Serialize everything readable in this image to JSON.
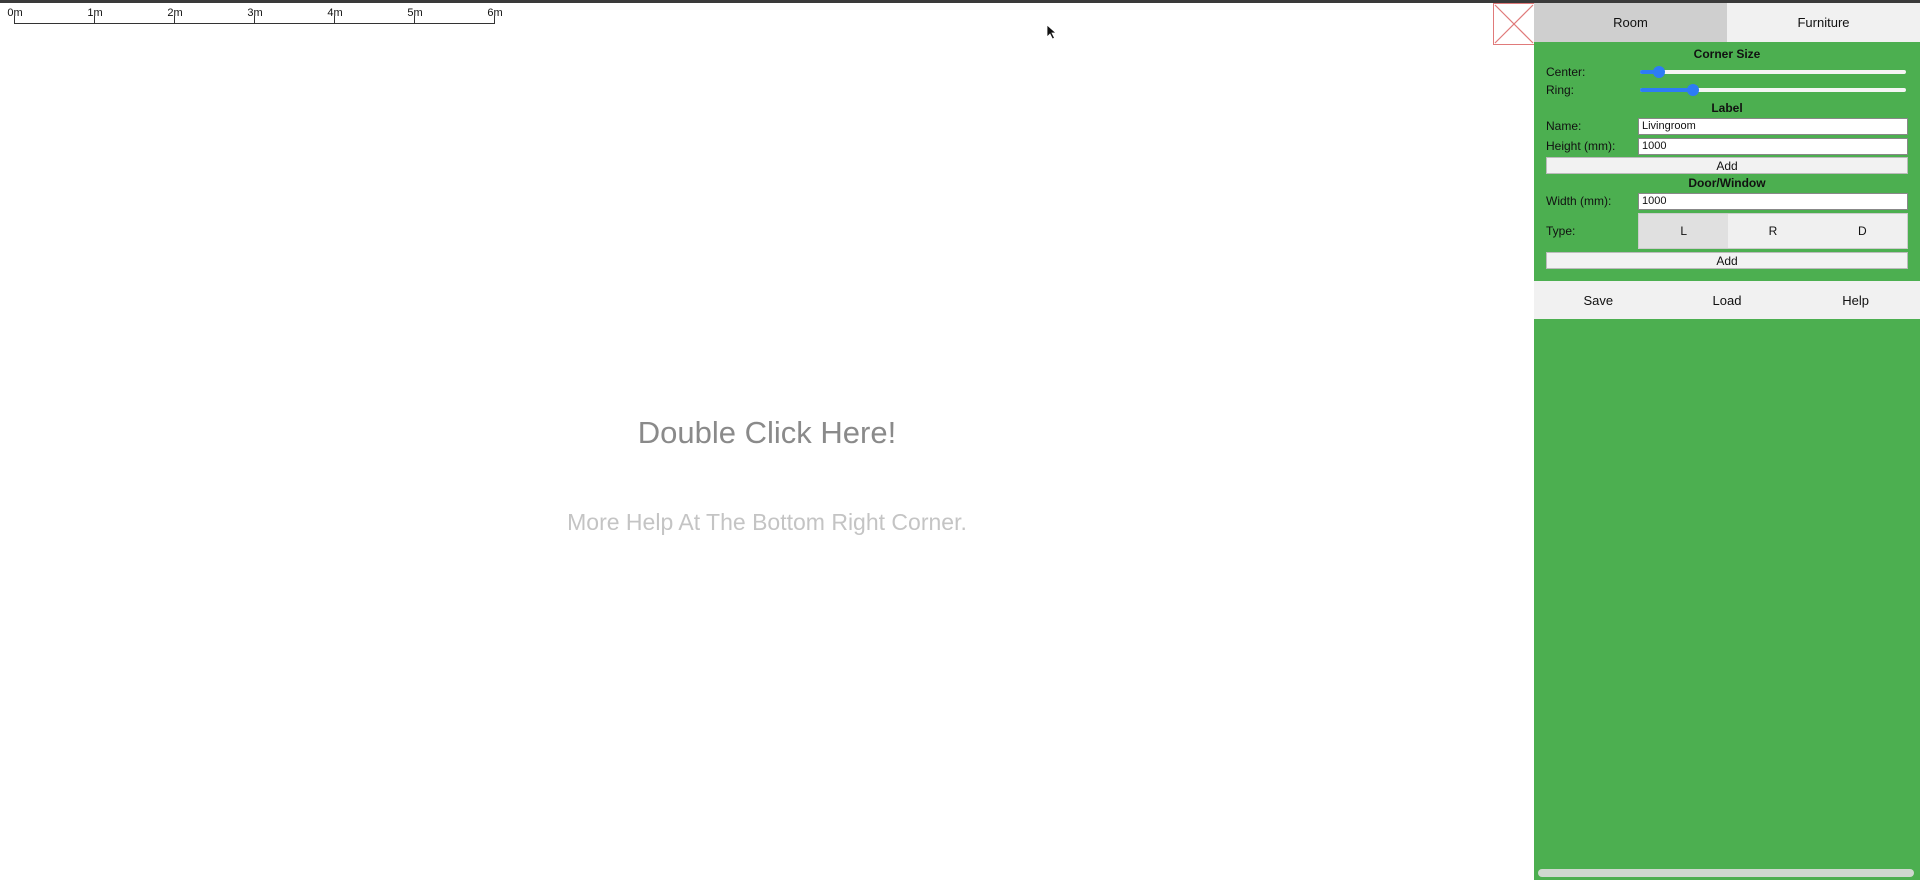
{
  "ruler": {
    "labels": [
      "0m",
      "1m",
      "2m",
      "3m",
      "4m",
      "5m",
      "6m"
    ]
  },
  "canvas": {
    "hint_main": "Double Click Here!",
    "hint_sub": "More Help At The Bottom Right Corner."
  },
  "panel": {
    "tabs": [
      {
        "label": "Room",
        "active": true
      },
      {
        "label": "Furniture",
        "active": false
      }
    ],
    "corner_size": {
      "title": "Corner Size",
      "center_label": "Center:",
      "center_value": 0.07,
      "ring_label": "Ring:",
      "ring_value": 0.2
    },
    "label_section": {
      "title": "Label",
      "name_label": "Name:",
      "name_value": "Livingroom",
      "height_label": "Height (mm):",
      "height_value": "1000",
      "add_label": "Add"
    },
    "door_window": {
      "title": "Door/Window",
      "width_label": "Width (mm):",
      "width_value": "1000",
      "type_label": "Type:",
      "types": [
        {
          "label": "L",
          "active": true
        },
        {
          "label": "R",
          "active": false
        },
        {
          "label": "D",
          "active": false
        }
      ],
      "add_label": "Add"
    },
    "bottom": {
      "save_label": "Save",
      "load_label": "Load",
      "help_label": "Help"
    }
  },
  "colors": {
    "panel_green": "#4caf50",
    "slider_blue": "#2d7cf6",
    "toggle_red": "#e07a7a"
  }
}
